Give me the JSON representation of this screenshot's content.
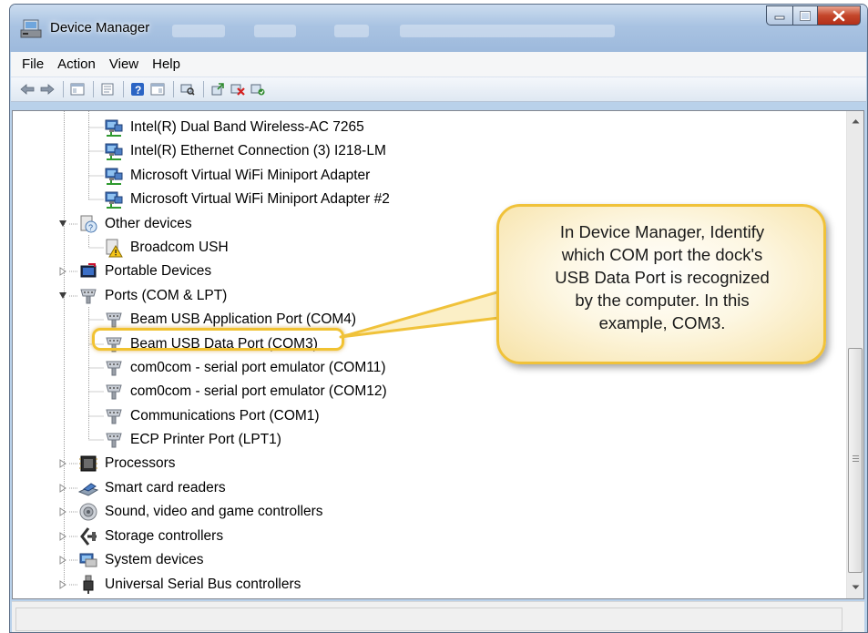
{
  "window": {
    "title": "Device Manager"
  },
  "menubar": {
    "items": [
      "File",
      "Action",
      "View",
      "Help"
    ]
  },
  "toolbar": {
    "buttons": [
      "back-arrow-icon",
      "forward-arrow-icon",
      "show-hide-tree-icon",
      "properties-icon",
      "help-icon",
      "view-icon",
      "scan-hardware-icon",
      "update-driver-icon",
      "uninstall-icon",
      "enable-device-icon"
    ]
  },
  "tree": {
    "network_adapters": [
      "Intel(R) Dual Band Wireless-AC 7265",
      "Intel(R) Ethernet Connection (3) I218-LM",
      "Microsoft Virtual WiFi Miniport Adapter",
      "Microsoft Virtual WiFi Miniport Adapter #2"
    ],
    "other_devices": {
      "label": "Other devices",
      "children": [
        "Broadcom USH"
      ]
    },
    "portable_devices": "Portable Devices",
    "ports": {
      "label": "Ports (COM & LPT)",
      "children": [
        "Beam USB Application Port (COM4)",
        "Beam USB Data Port (COM3)",
        "com0com - serial port emulator (COM11)",
        "com0com - serial port emulator (COM12)",
        "Communications Port (COM1)",
        "ECP Printer Port (LPT1)"
      ]
    },
    "categories": [
      "Processors",
      "Smart card readers",
      "Sound, video and game controllers",
      "Storage controllers",
      "System devices",
      "Universal Serial Bus controllers"
    ]
  },
  "callout": {
    "lines": [
      "In Device Manager, Identify",
      "which COM port the dock's",
      "USB Data Port is recognized",
      "by the computer.  In this",
      "example, COM3."
    ],
    "border_color": "#f0c23a"
  }
}
